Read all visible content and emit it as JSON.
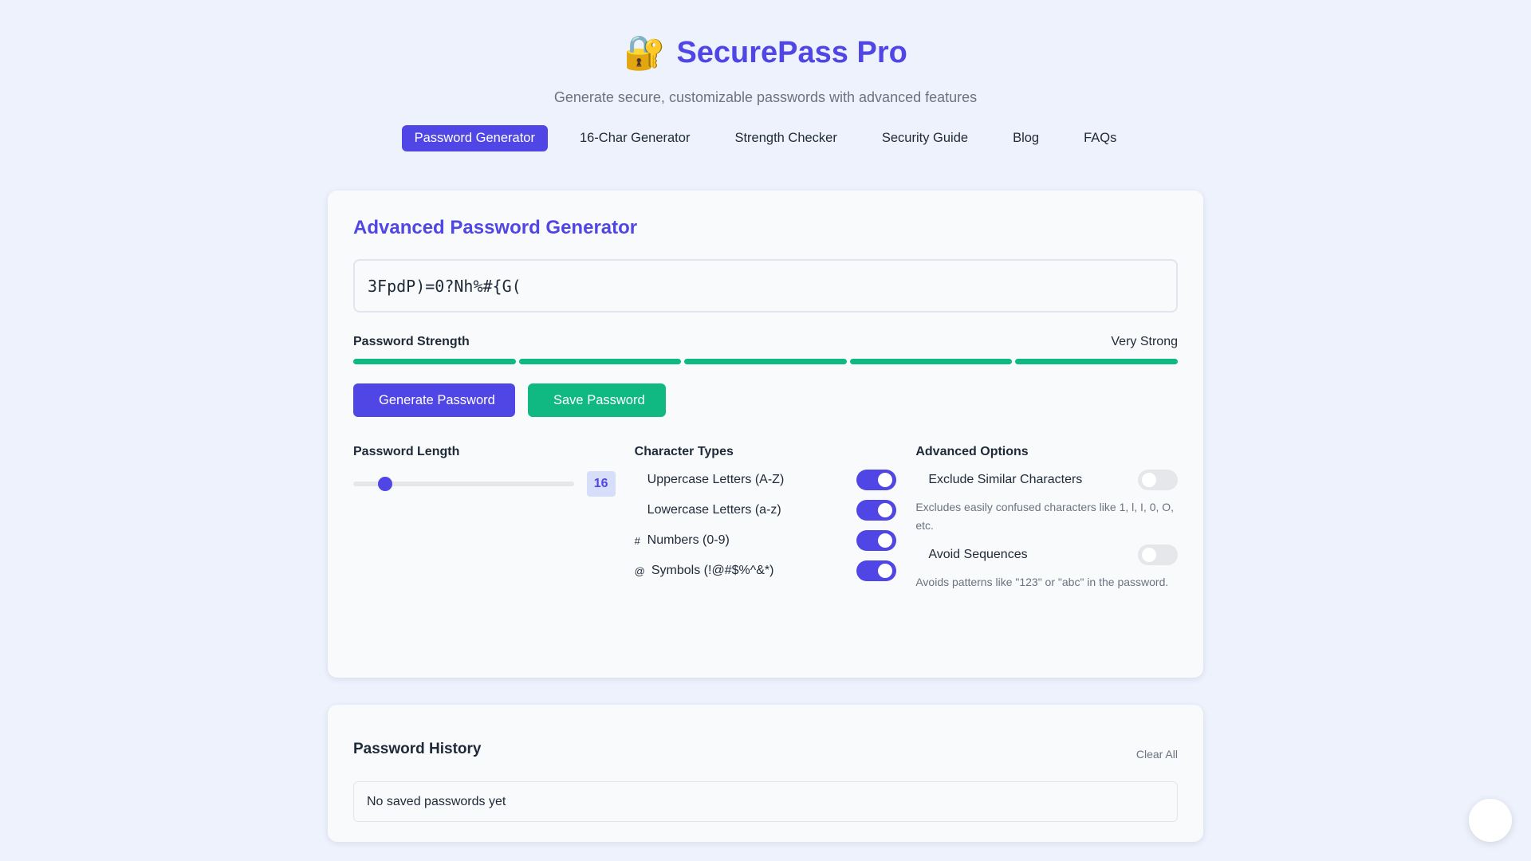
{
  "header": {
    "logo_emoji": "🔐",
    "title": "SecurePass Pro",
    "subtitle": "Generate secure, customizable passwords with advanced features"
  },
  "nav": {
    "items": [
      {
        "label": "Password Generator",
        "active": true
      },
      {
        "label": "16-Char Generator"
      },
      {
        "label": "Strength Checker"
      },
      {
        "label": "Security Guide"
      },
      {
        "label": "Blog"
      },
      {
        "label": "FAQs"
      }
    ]
  },
  "generator": {
    "title": "Advanced Password Generator",
    "password": "3FpdP)=0?Nh%#{G(",
    "copy_icon": "",
    "strength_label": "Password Strength",
    "strength_value": "Very Strong",
    "strength_level": 5,
    "strength_max": 5,
    "strength_color": "#10b981",
    "generate_icon": "",
    "generate_label": "Generate Password",
    "save_icon": "",
    "save_label": "Save Password",
    "length": {
      "label": "Password Length",
      "info_icon": "",
      "value": "16",
      "min": 8,
      "max": 64
    },
    "char_types": {
      "label": "Character Types",
      "info_icon": "",
      "items": [
        {
          "icon": "",
          "label": "Uppercase Letters (A-Z)",
          "on": true
        },
        {
          "icon": "",
          "label": "Lowercase Letters (a-z)",
          "on": true
        },
        {
          "icon": "#",
          "label": "Numbers (0-9)",
          "on": true
        },
        {
          "icon": "@",
          "label": "Symbols (!@#$%^&*)",
          "on": true
        }
      ]
    },
    "advanced": {
      "label": "Advanced Options",
      "items": [
        {
          "icon": "",
          "label": "Exclude Similar Characters",
          "on": false,
          "desc": "Excludes easily confused characters like 1, l, I, 0, O, etc."
        },
        {
          "icon": "",
          "label": "Avoid Sequences",
          "on": false,
          "desc": "Avoids patterns like \"123\" or \"abc\" in the password."
        }
      ]
    }
  },
  "history": {
    "title": "Password History",
    "clear_label": "Clear All",
    "empty_text": "No saved passwords yet"
  },
  "fab_icon": "",
  "colors": {
    "accent": "#4f46e5",
    "success": "#10b981",
    "background": "#edf2fc"
  }
}
